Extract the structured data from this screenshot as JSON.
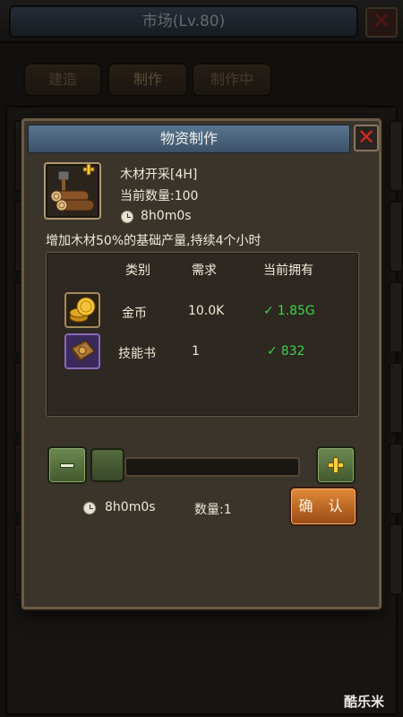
{
  "background": {
    "title": "市场(Lv.80)",
    "tabs": [
      {
        "label": "建造"
      },
      {
        "label": "制作"
      },
      {
        "label": "制作中"
      }
    ]
  },
  "dialog": {
    "title": "物资制作",
    "item": {
      "name": "木材开采[4H]",
      "quantity": "当前数量:100",
      "time": "8h0m0s",
      "icon": "wood-logs-icon"
    },
    "description": "增加木材50%的基础产量,持续4个小时",
    "table": {
      "headers": [
        "类别",
        "需求",
        "当前拥有"
      ],
      "rows": [
        {
          "icon": "gold-coin-icon",
          "category": "金币",
          "required": "10.0K",
          "owned": "1.85G"
        },
        {
          "icon": "skill-book-icon",
          "category": "技能书",
          "required": "1",
          "owned": "832"
        }
      ]
    },
    "slider": {
      "level": 0
    },
    "footer": {
      "time": "8h0m0s",
      "quantity": "数量:1",
      "confirm_label": "确 认"
    }
  },
  "watermark": "酷乐米",
  "colors": {
    "header_blue": "#4d6780",
    "owned_green": "#3cd44a",
    "confirm_orange": "#d07a30",
    "step_green": "#58703f"
  }
}
